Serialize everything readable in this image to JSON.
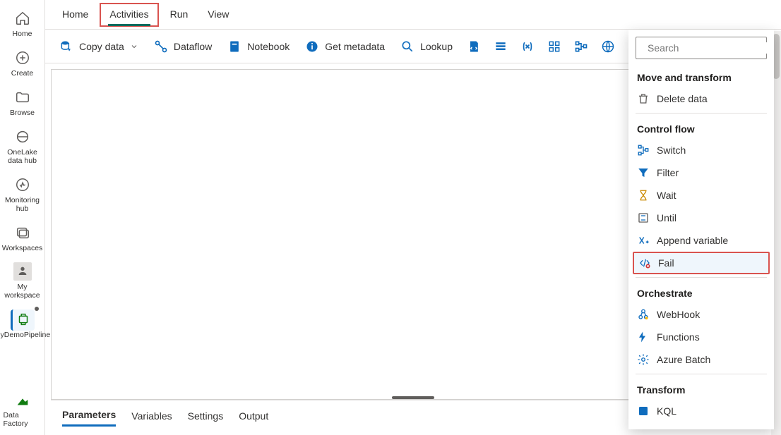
{
  "rail": {
    "home": "Home",
    "create": "Create",
    "browse": "Browse",
    "onelake": "OneLake data hub",
    "monitoring": "Monitoring hub",
    "workspaces": "Workspaces",
    "myworkspace": "My workspace",
    "pipeline": "MyDemoPipeline",
    "datafactory": "Data Factory"
  },
  "tabs": {
    "home": "Home",
    "activities": "Activities",
    "run": "Run",
    "view": "View"
  },
  "toolbar": {
    "copydata": "Copy data",
    "dataflow": "Dataflow",
    "notebook": "Notebook",
    "getmeta": "Get metadata",
    "lookup": "Lookup"
  },
  "bottom": {
    "params": "Parameters",
    "vars": "Variables",
    "settings": "Settings",
    "output": "Output"
  },
  "dropdown": {
    "search_ph": "Search",
    "g1": "Move and transform",
    "i_delete": "Delete data",
    "g2": "Control flow",
    "i_switch": "Switch",
    "i_filter": "Filter",
    "i_wait": "Wait",
    "i_until": "Until",
    "i_append": "Append variable",
    "i_fail": "Fail",
    "g3": "Orchestrate",
    "i_webhook": "WebHook",
    "i_functions": "Functions",
    "i_batch": "Azure Batch",
    "g4": "Transform",
    "i_kql": "KQL"
  }
}
